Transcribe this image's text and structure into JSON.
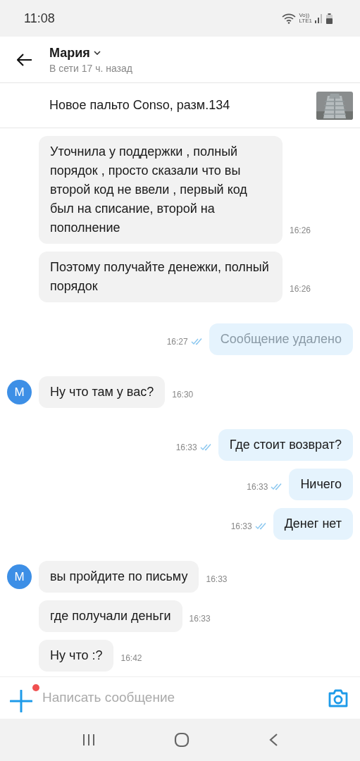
{
  "status_bar": {
    "time": "11:08",
    "network_top": "Vo))",
    "network_bottom": "LTE1"
  },
  "header": {
    "name": "Мария",
    "presence": "В сети 17 ч. назад"
  },
  "listing": {
    "title": "Новое пальто Conso, разм.134"
  },
  "messages": [
    {
      "kind": "incoming",
      "text": "Уточнила у поддержки , полный порядок , просто сказали что вы второй код не ввели , первый код был на списание, второй на пополнение",
      "time": "16:26"
    },
    {
      "kind": "incoming",
      "text": "Поэтому получайте денежки, полный порядок",
      "time": "16:26"
    },
    {
      "kind": "outgoing",
      "text": "Сообщение удалено",
      "time": "16:27",
      "read": true,
      "deleted": true
    },
    {
      "kind": "incoming",
      "avatar": "М",
      "text": "Ну что там у вас?",
      "time": "16:30"
    },
    {
      "kind": "outgoing",
      "text": "Где стоит возврат?",
      "time": "16:33",
      "read": true,
      "deleted": false
    },
    {
      "kind": "outgoing",
      "text": "Ничего",
      "time": "16:33",
      "read": true,
      "deleted": false
    },
    {
      "kind": "outgoing",
      "text": "Денег нет",
      "time": "16:33",
      "read": true,
      "deleted": false
    },
    {
      "kind": "incoming",
      "avatar": "М",
      "text": "вы пройдите по письму",
      "time": "16:33"
    },
    {
      "kind": "incoming",
      "text": "где получали деньги",
      "time": "16:33"
    },
    {
      "kind": "incoming",
      "text": "Ну что :?",
      "time": "16:42"
    }
  ],
  "composer": {
    "placeholder": "Написать сообщение",
    "attach_badge": true
  }
}
